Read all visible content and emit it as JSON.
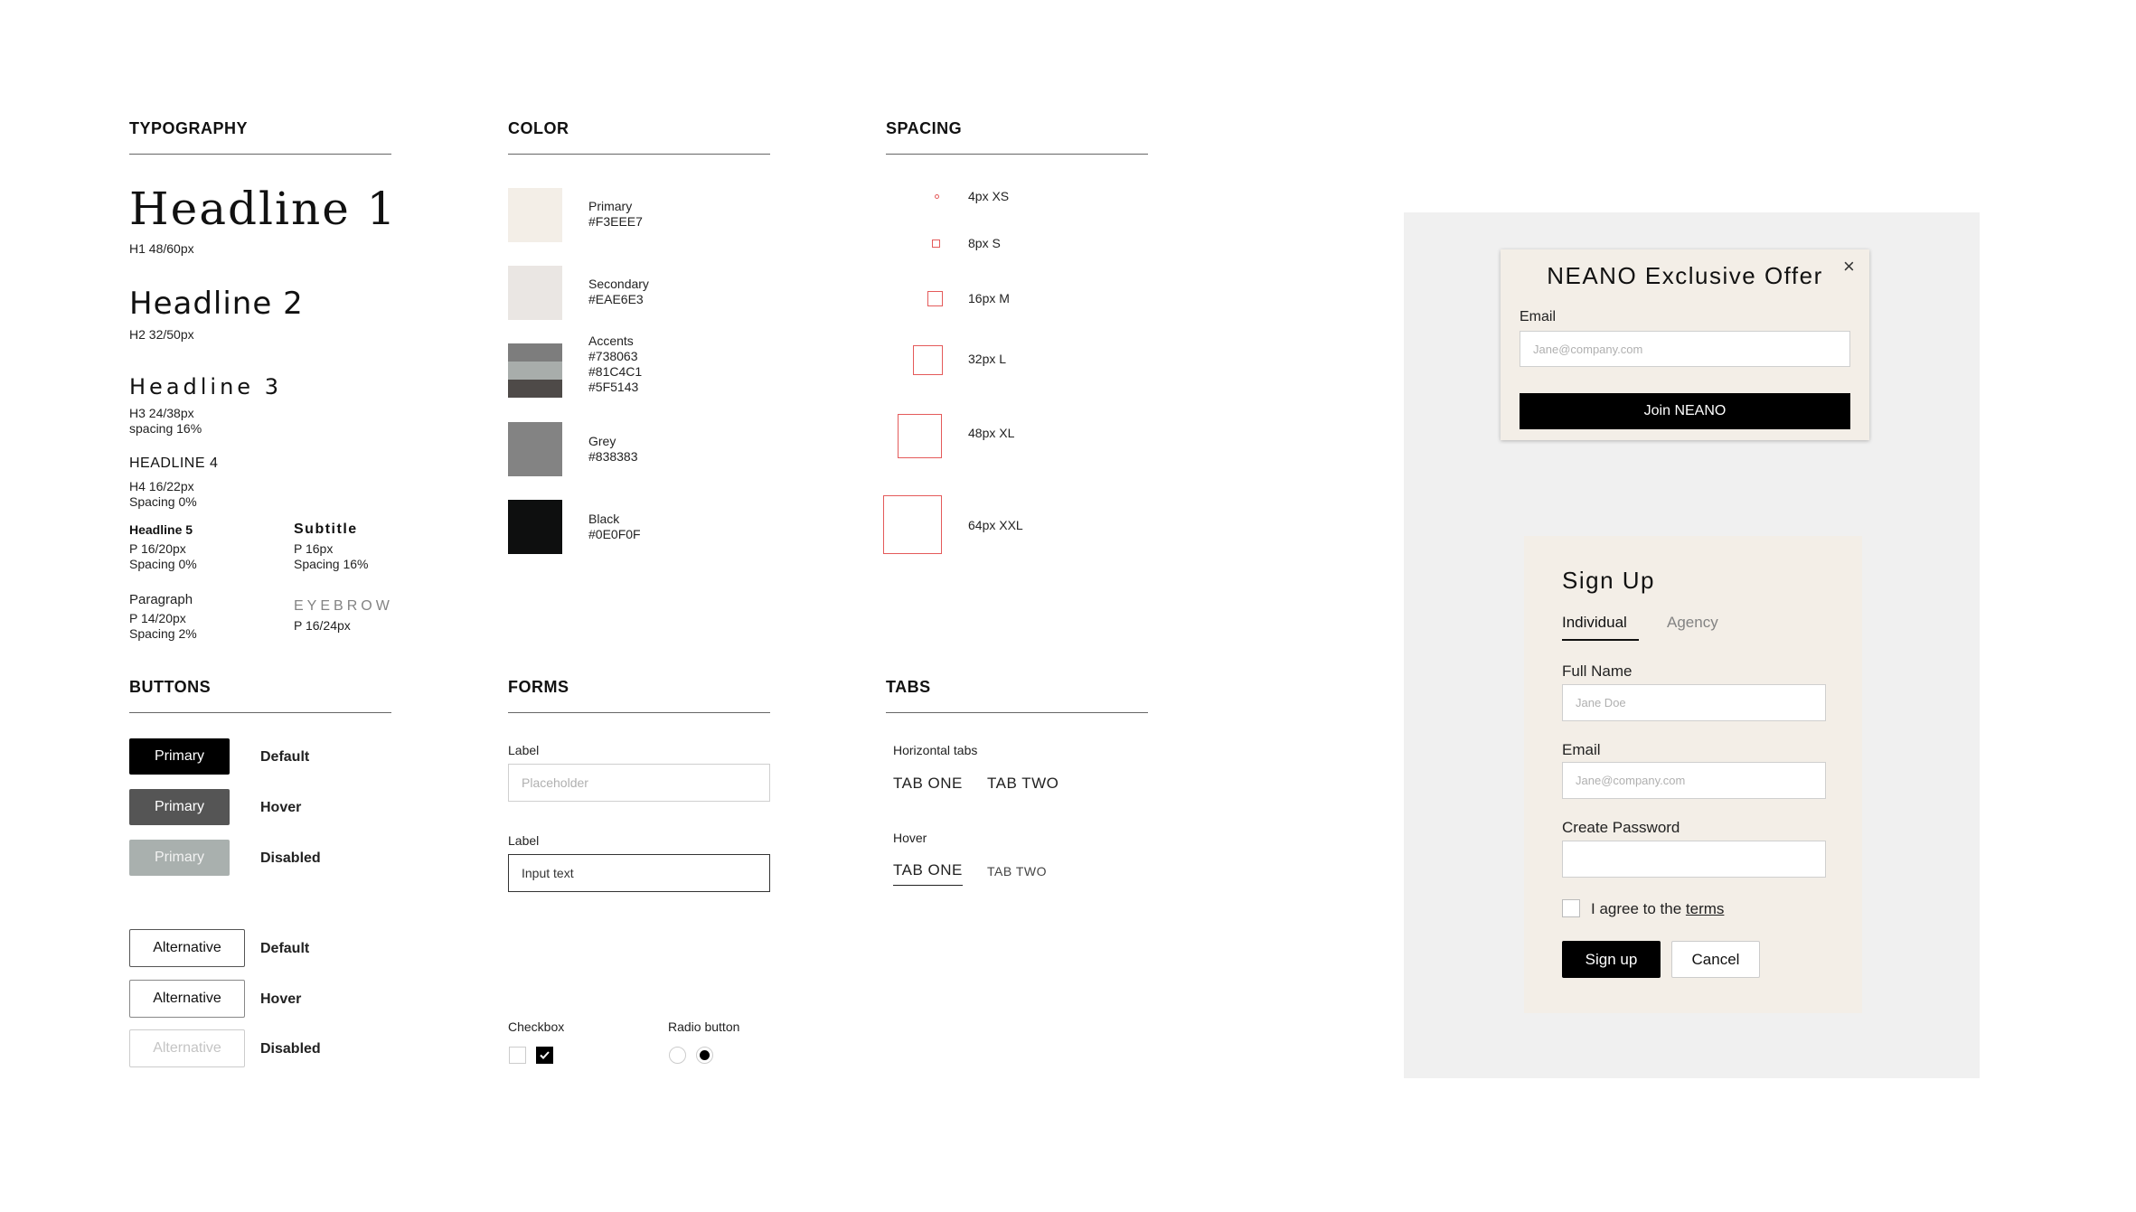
{
  "sections": {
    "typography": "TYPOGRAPHY",
    "color": "COLOR",
    "spacing": "SPACING",
    "buttons": "BUTTONS",
    "forms": "FORMS",
    "tabs": "TABS"
  },
  "typography": {
    "h1": {
      "sample": "Headline 1",
      "spec": "H1 48/60px"
    },
    "h2": {
      "sample": "Headline 2",
      "spec": "H2 32/50px"
    },
    "h3": {
      "sample": "Headline 3",
      "spec1": "H3 24/38px",
      "spec2": "spacing 16%"
    },
    "h4": {
      "sample": "HEADLINE 4",
      "spec1": "H4 16/22px",
      "spec2": "Spacing 0%"
    },
    "h5": {
      "sample": "Headline 5",
      "spec1": "P 16/20px",
      "spec2": "Spacing 0%"
    },
    "subtitle": {
      "sample": "Subtitle",
      "spec1": "P 16px",
      "spec2": "Spacing 16%"
    },
    "paragraph": {
      "sample": "Paragraph",
      "spec1": "P 14/20px",
      "spec2": "Spacing 2%"
    },
    "eyebrow": {
      "sample": "EYEBROW",
      "spec1": "P 16/24px"
    }
  },
  "colors": [
    {
      "name": "Primary",
      "hex": "#F3EEE7",
      "swatch": "#F3EEE7"
    },
    {
      "name": "Secondary",
      "hex": "#EAE6E3",
      "swatch": "#EAE6E3"
    },
    {
      "name": "Accents",
      "hex1": "#738063",
      "hex2": "#81C4C1",
      "hex3": "#5F5143",
      "swatches": [
        "#7d7d7d",
        "#a8adab",
        "#4e4a48"
      ]
    },
    {
      "name": "Grey",
      "hex": "#838383",
      "swatch": "#838383"
    },
    {
      "name": "Black",
      "hex": "#0E0F0F",
      "swatch": "#0E0F0F"
    }
  ],
  "spacing": [
    {
      "label": "4px XS"
    },
    {
      "label": "8px S"
    },
    {
      "label": "16px M"
    },
    {
      "label": "32px L"
    },
    {
      "label": "48px XL"
    },
    {
      "label": "64px XXL"
    }
  ],
  "buttons": {
    "primary_label": "Primary",
    "alternative_label": "Alternative",
    "states": {
      "default": "Default",
      "hover": "Hover",
      "disabled": "Disabled"
    }
  },
  "forms": {
    "label1": "Label",
    "placeholder": "Placeholder",
    "label2": "Label",
    "input_text": "Input text",
    "checkbox_label": "Checkbox",
    "radio_label": "Radio button"
  },
  "tabs": {
    "horizontal_label": "Horizontal tabs",
    "tab_one": "TAB ONE",
    "tab_two": "TAB TWO",
    "hover_label": "Hover"
  },
  "modal": {
    "title": "NEANO Exclusive Offer",
    "email_label": "Email",
    "email_placeholder": "Jane@company.com",
    "join_button": "Join NEANO",
    "close": "×"
  },
  "signup": {
    "title": "Sign Up",
    "tab_individual": "Individual",
    "tab_agency": "Agency",
    "fullname_label": "Full Name",
    "fullname_placeholder": "Jane Doe",
    "email_label": "Email",
    "email_placeholder": "Jane@company.com",
    "password_label": "Create Password",
    "agree_text": "I agree to the ",
    "terms_link": "terms",
    "signup_button": "Sign up",
    "cancel_button": "Cancel"
  }
}
